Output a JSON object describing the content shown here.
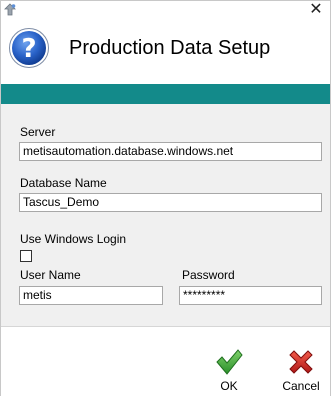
{
  "window": {
    "close_glyph": "✕"
  },
  "header": {
    "title": "Production Data Setup",
    "icon": "question-icon"
  },
  "colors": {
    "band": "#138a8a",
    "ok_check": "#3aa63a",
    "cancel_x": "#d62020",
    "question_blue": "#1f5fc7"
  },
  "form": {
    "server_label": "Server",
    "server_value": "metisautomation.database.windows.net",
    "database_label": "Database Name",
    "database_value": "Tascus_Demo",
    "windows_login_label": "Use Windows Login",
    "windows_login_checked": false,
    "username_label": "User Name",
    "username_value": "metis",
    "password_label": "Password",
    "password_value": "*********"
  },
  "actions": {
    "ok_label": "OK",
    "cancel_label": "Cancel"
  }
}
